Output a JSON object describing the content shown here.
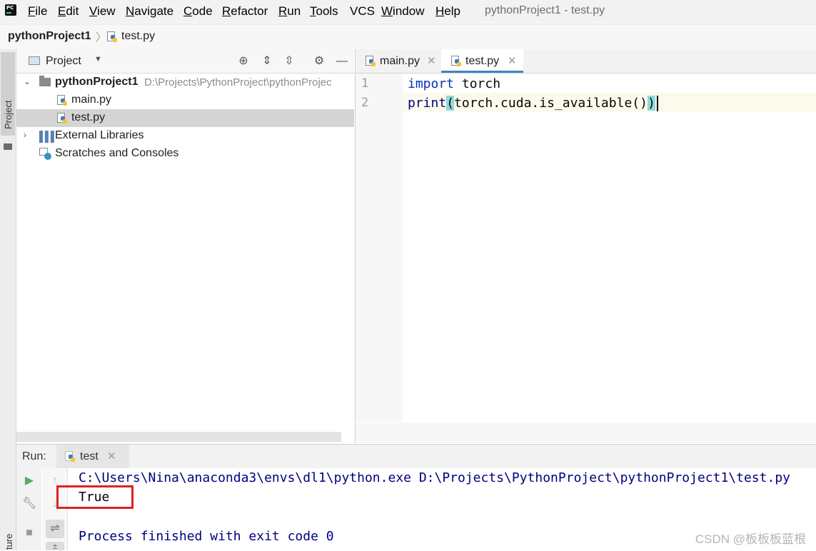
{
  "app": {
    "icon_label": "PC",
    "window_title": "pythonProject1 - test.py",
    "menu": [
      {
        "mn": "F",
        "rest": "ile"
      },
      {
        "mn": "E",
        "rest": "dit"
      },
      {
        "mn": "V",
        "rest": "iew"
      },
      {
        "mn": "N",
        "rest": "avigate"
      },
      {
        "mn": "C",
        "rest": "ode"
      },
      {
        "mn": "R",
        "rest": "efactor"
      },
      {
        "mn": "R",
        "rest": "un"
      },
      {
        "mn": "T",
        "rest": "ools"
      },
      {
        "mn": "",
        "rest": "VCS"
      },
      {
        "mn": "W",
        "rest": "indow"
      },
      {
        "mn": "H",
        "rest": "elp"
      }
    ]
  },
  "breadcrumb": {
    "project": "pythonProject1",
    "separator": "〉",
    "file": "test.py"
  },
  "left_stripe": {
    "project_label": "Project",
    "structure_label": "ture"
  },
  "project_panel": {
    "title": "Project",
    "tree": {
      "root_name": "pythonProject1",
      "root_path": "D:\\Projects\\PythonProject\\pythonProjec",
      "files": [
        "main.py",
        "test.py"
      ],
      "selected_file": "test.py",
      "external_libraries": "External Libraries",
      "scratches": "Scratches and Consoles"
    }
  },
  "editor": {
    "tabs": [
      {
        "label": "main.py",
        "active": false
      },
      {
        "label": "test.py",
        "active": true
      }
    ],
    "line_numbers": [
      "1",
      "2"
    ],
    "code": {
      "line1_keyword": "import",
      "line1_rest": " torch",
      "line2_fn": "print",
      "line2_open": "(",
      "line2_body": "torch.cuda.is_available()",
      "line2_close": ")"
    }
  },
  "run_panel": {
    "label": "Run:",
    "tab_label": "test",
    "console": {
      "command": "C:\\Users\\Nina\\anaconda3\\envs\\dl1\\python.exe D:\\Projects\\PythonProject\\pythonProject1\\test.py",
      "output": "True",
      "exit_message": "Process finished with exit code 0"
    }
  },
  "watermark": "CSDN @板板板蓝根",
  "colors": {
    "keyword": "#0033b3",
    "console_text": "#000080",
    "tab_underline": "#4083c9",
    "highlight_box": "#e02020",
    "run_icon": "#59a869"
  }
}
